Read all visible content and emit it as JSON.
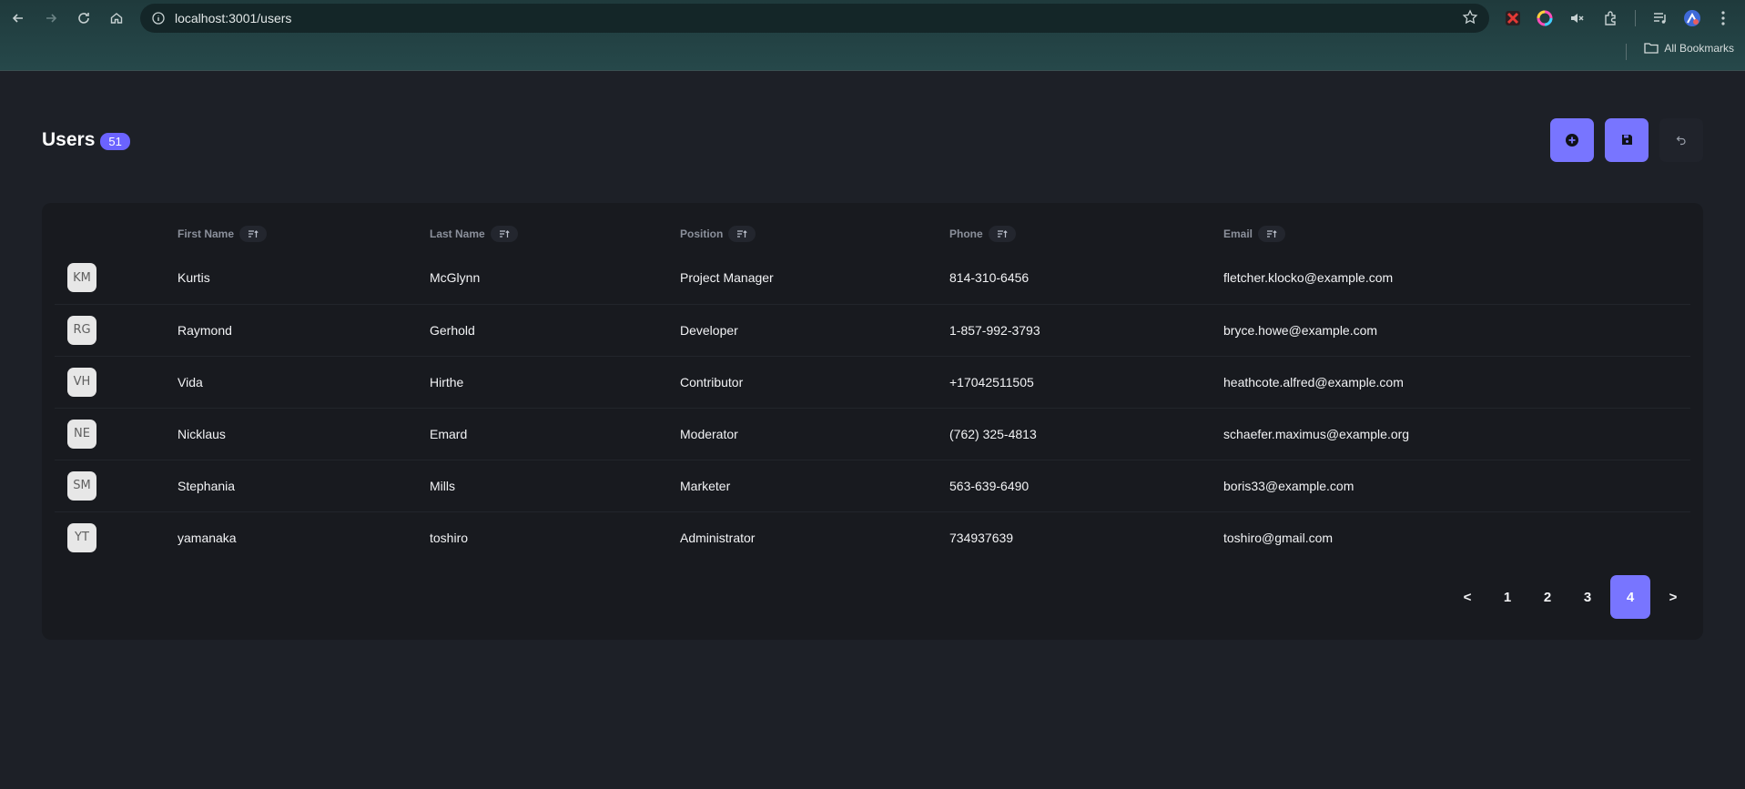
{
  "browser": {
    "url": "localhost:3001/users",
    "bookmarks_label": "All Bookmarks"
  },
  "header": {
    "title": "Users",
    "count": "51"
  },
  "table": {
    "columns": [
      "First Name",
      "Last Name",
      "Position",
      "Phone",
      "Email"
    ],
    "rows": [
      {
        "initials": "KM",
        "first": "Kurtis",
        "last": "McGlynn",
        "position": "Project Manager",
        "phone": "814-310-6456",
        "email": "fletcher.klocko@example.com"
      },
      {
        "initials": "RG",
        "first": "Raymond",
        "last": "Gerhold",
        "position": "Developer",
        "phone": "1-857-992-3793",
        "email": "bryce.howe@example.com"
      },
      {
        "initials": "VH",
        "first": "Vida",
        "last": "Hirthe",
        "position": "Contributor",
        "phone": "+17042511505",
        "email": "heathcote.alfred@example.com"
      },
      {
        "initials": "NE",
        "first": "Nicklaus",
        "last": "Emard",
        "position": "Moderator",
        "phone": "(762) 325-4813",
        "email": "schaefer.maximus@example.org"
      },
      {
        "initials": "SM",
        "first": "Stephania",
        "last": "Mills",
        "position": "Marketer",
        "phone": "563-639-6490",
        "email": "boris33@example.com"
      },
      {
        "initials": "YT",
        "first": "yamanaka",
        "last": "toshiro",
        "position": "Administrator",
        "phone": "734937639",
        "email": "toshiro@gmail.com"
      }
    ]
  },
  "pagination": {
    "prev": "<",
    "pages": [
      "1",
      "2",
      "3",
      "4"
    ],
    "current": "4",
    "next": ">"
  },
  "colors": {
    "accent": "#7875ff",
    "background": "#1d2027",
    "card": "#181a1f"
  }
}
